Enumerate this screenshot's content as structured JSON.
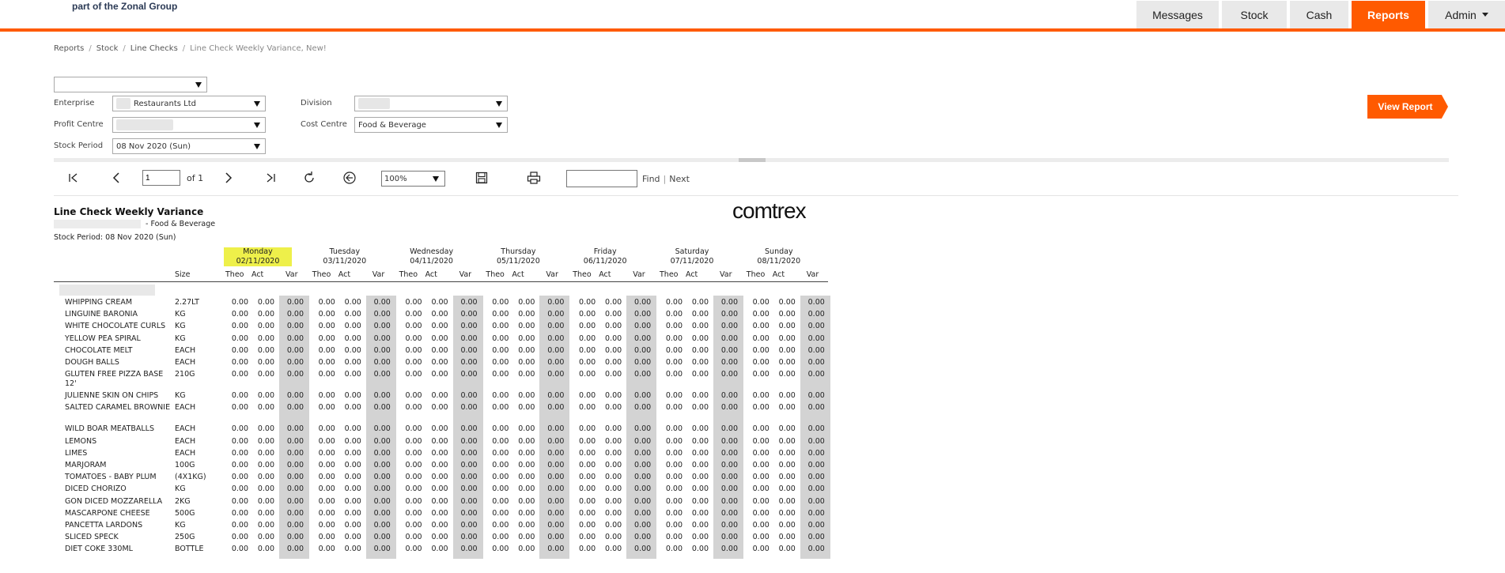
{
  "header": {
    "brand_text": "part of the Zonal Group",
    "nav": [
      {
        "label": "Messages",
        "active": false
      },
      {
        "label": "Stock",
        "active": false
      },
      {
        "label": "Cash",
        "active": false
      },
      {
        "label": "Reports",
        "active": true
      },
      {
        "label": "Admin",
        "active": false,
        "dropdown": true
      }
    ],
    "accent_color": "#ff5a00"
  },
  "breadcrumb": [
    "Reports",
    "Stock",
    "Line Checks",
    "Line Check Weekly Variance, New!"
  ],
  "filters": {
    "top_select": "",
    "enterprise_label": "Enterprise",
    "enterprise_value": "Restaurants Ltd",
    "division_label": "Division",
    "division_value": "",
    "profit_centre_label": "Profit Centre",
    "profit_centre_value": "",
    "cost_centre_label": "Cost Centre",
    "cost_centre_value": "Food & Beverage",
    "stock_period_label": "Stock Period",
    "stock_period_value": "08 Nov 2020 (Sun)",
    "view_report_label": "View Report"
  },
  "toolbar": {
    "page_value": "1",
    "of_label": "of 1",
    "zoom_value": "100%",
    "find_label": "Find",
    "next_label": "Next",
    "icons": [
      "first-page-icon",
      "previous-page-icon",
      "next-page-icon",
      "last-page-icon",
      "refresh-icon",
      "back-icon",
      "save-icon",
      "print-icon"
    ]
  },
  "report": {
    "title": "Line Check Weekly Variance",
    "subtitle": "- Food & Beverage",
    "stock_period": "Stock Period: 08 Nov 2020 (Sun)",
    "logo": "comtrex",
    "size_header": "Size",
    "col_labels": [
      "Theo",
      "Act",
      "Var"
    ],
    "days": [
      {
        "name": "Monday",
        "date": "02/11/2020",
        "highlight": true
      },
      {
        "name": "Tuesday",
        "date": "03/11/2020",
        "highlight": false
      },
      {
        "name": "Wednesday",
        "date": "04/11/2020",
        "highlight": false
      },
      {
        "name": "Thursday",
        "date": "05/11/2020",
        "highlight": false
      },
      {
        "name": "Friday",
        "date": "06/11/2020",
        "highlight": false
      },
      {
        "name": "Saturday",
        "date": "07/11/2020",
        "highlight": false
      },
      {
        "name": "Sunday",
        "date": "08/11/2020",
        "highlight": false
      }
    ],
    "cell_value": "0.00",
    "rows": [
      {
        "name": "WHIPPING CREAM",
        "size": "2.27LT"
      },
      {
        "name": "LINGUINE BARONIA",
        "size": "KG"
      },
      {
        "name": "WHITE CHOCOLATE CURLS",
        "size": "KG"
      },
      {
        "name": "YELLOW PEA SPIRAL",
        "size": "KG"
      },
      {
        "name": "CHOCOLATE MELT",
        "size": "EACH"
      },
      {
        "name": "DOUGH BALLS",
        "size": "EACH"
      },
      {
        "name": "GLUTEN FREE PIZZA BASE 12'",
        "size": "210G"
      },
      {
        "name": "JULIENNE SKIN ON CHIPS",
        "size": "KG"
      },
      {
        "name": "SALTED CARAMEL BROWNIE",
        "size": "EACH"
      },
      {
        "name": "WILD BOAR MEATBALLS",
        "size": "EACH"
      },
      {
        "name": "LEMONS",
        "size": "EACH"
      },
      {
        "name": "LIMES",
        "size": "EACH"
      },
      {
        "name": "MARJORAM",
        "size": "100G"
      },
      {
        "name": "TOMATOES - BABY PLUM",
        "size": "(4X1KG)"
      },
      {
        "name": "DICED CHORIZO",
        "size": "KG"
      },
      {
        "name": "GON DICED MOZZARELLA",
        "size": "2KG"
      },
      {
        "name": "MASCARPONE CHEESE",
        "size": "500G"
      },
      {
        "name": "PANCETTA LARDONS",
        "size": "KG"
      },
      {
        "name": "SLICED SPECK",
        "size": "250G"
      },
      {
        "name": "DIET COKE 330ML",
        "size": "BOTTLE"
      }
    ]
  }
}
